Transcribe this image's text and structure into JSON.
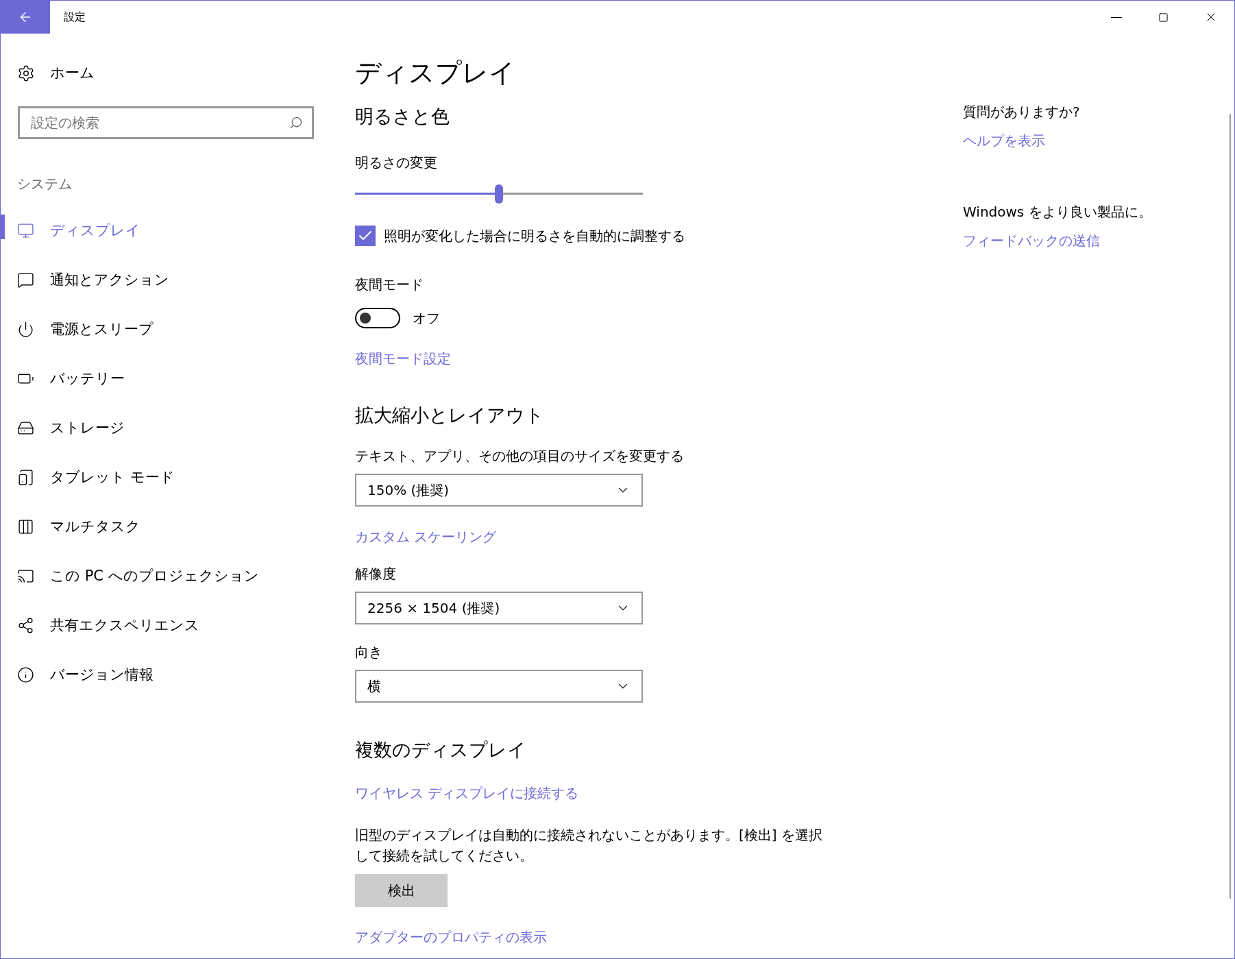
{
  "window": {
    "title": "設定"
  },
  "sidebar": {
    "home": "ホーム",
    "search": {
      "placeholder": "設定の検索"
    },
    "section": "システム",
    "items": [
      {
        "label": "ディスプレイ",
        "selected": true
      },
      {
        "label": "通知とアクション",
        "selected": false
      },
      {
        "label": "電源とスリープ",
        "selected": false
      },
      {
        "label": "バッテリー",
        "selected": false
      },
      {
        "label": "ストレージ",
        "selected": false
      },
      {
        "label": "タブレット モード",
        "selected": false
      },
      {
        "label": "マルチタスク",
        "selected": false
      },
      {
        "label": "この PC へのプロジェクション",
        "selected": false
      },
      {
        "label": "共有エクスペリエンス",
        "selected": false
      },
      {
        "label": "バージョン情報",
        "selected": false
      }
    ]
  },
  "content": {
    "title": "ディスプレイ",
    "sections": [
      {
        "heading": "明るさと色",
        "controls": [
          {
            "kind": "slider",
            "label": "明るさの変更",
            "level": 0.5
          },
          {
            "kind": "checkbox",
            "label": "照明が変化した場合に明るさを自動的に調整する",
            "checked": true
          },
          {
            "kind": "toggle",
            "label": "夜間モード",
            "on": false,
            "state_text": "オフ"
          },
          {
            "kind": "link",
            "label": "夜間モード設定"
          }
        ]
      },
      {
        "heading": "拡大縮小とレイアウト",
        "controls": [
          {
            "kind": "dropdown",
            "label": "テキスト、アプリ、その他の項目のサイズを変更する",
            "value": "150% (推奨)"
          },
          {
            "kind": "link",
            "label": "カスタム スケーリング"
          },
          {
            "kind": "dropdown",
            "label": "解像度",
            "value": "2256 × 1504 (推奨)"
          },
          {
            "kind": "dropdown",
            "label": "向き",
            "value": "横"
          }
        ]
      },
      {
        "heading": "複数のディスプレイ",
        "controls": [
          {
            "kind": "link",
            "label": "ワイヤレス ディスプレイに接続する"
          },
          {
            "kind": "text",
            "text": "旧型のディスプレイは自動的に接続されないことがあります。[検出] を選択して接続を試してください。"
          },
          {
            "kind": "button",
            "label": "検出"
          },
          {
            "kind": "link",
            "label": "アダプターのプロパティの表示"
          }
        ]
      }
    ]
  },
  "aside": [
    {
      "title": "質問がありますか?",
      "link": "ヘルプを表示"
    },
    {
      "title": "Windows をより良い製品に。",
      "link": "フィードバックの送信"
    }
  ]
}
